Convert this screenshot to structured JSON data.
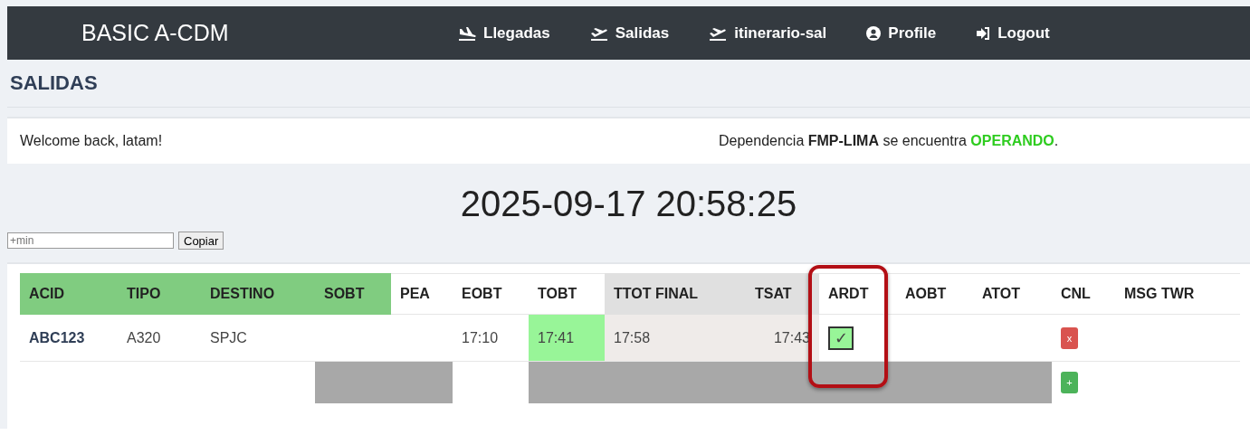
{
  "navbar": {
    "brand": "BASIC A-CDM",
    "items": [
      {
        "kind": "arrival",
        "label": "Llegadas"
      },
      {
        "kind": "departure",
        "label": "Salidas"
      },
      {
        "kind": "departure",
        "label": "itinerario-sal"
      },
      {
        "kind": "user",
        "label": "Profile"
      },
      {
        "kind": "logout",
        "label": "Logout"
      }
    ]
  },
  "page_title": "SALIDAS",
  "welcome": "Welcome back, latam!",
  "status": {
    "text": "Dependencia **FMP-LIMA** se encuentra",
    "state": "OPERANDO",
    "color": "#2ecc1f",
    "suffix": "."
  },
  "clock": "2025-09-17 20:58:25",
  "offset_field": {
    "placeholder": "+min"
  },
  "copy_button": "Copiar",
  "table": {
    "columns": [
      {
        "label": "ACID",
        "color": "#80cc80",
        "highlighted": false
      },
      {
        "label": "TIPO",
        "color": "#80cc80",
        "highlighted": false
      },
      {
        "label": "DESTINO",
        "color": "#80cc80",
        "highlighted": false
      },
      {
        "label": "SOBT",
        "color": "#80cc80",
        "highlighted": false
      },
      {
        "label": "PEA",
        "highlighted": false
      },
      {
        "label": "EOBT",
        "highlighted": false
      },
      {
        "label": "TOBT",
        "highlighted": false
      },
      {
        "label": "TTOT FINAL",
        "color": "#e0e0e0",
        "highlighted": false
      },
      {
        "label": "TSAT",
        "color": "#e0e0e0",
        "highlighted": false
      },
      {
        "label": "ARDT",
        "highlighted": true
      },
      {
        "label": "AOBT",
        "highlighted": false
      },
      {
        "label": "ATOT",
        "highlighted": false
      },
      {
        "label": "CNL",
        "highlighted": false
      },
      {
        "label": "MSG TWR",
        "highlighted": false
      }
    ],
    "rows": [
      {
        "cells": [
          {
            "kind": "id",
            "text": "ABC123"
          },
          {
            "kind": "text",
            "text": "A320"
          },
          {
            "kind": "text",
            "text": "SPJC"
          },
          {
            "kind": "empty"
          },
          {
            "kind": "empty"
          },
          {
            "kind": "text",
            "text": "17:10"
          },
          {
            "kind": "text",
            "text": "17:41",
            "color": "#98f598"
          },
          {
            "kind": "text",
            "text": "17:58",
            "color": "#efebe9"
          },
          {
            "kind": "number",
            "text": "17:43",
            "color": "#efebe9"
          },
          {
            "kind": "check",
            "text": "✓",
            "checked": true
          },
          {
            "kind": "empty"
          },
          {
            "kind": "empty"
          },
          {
            "kind": "cancel",
            "text": "x"
          },
          {
            "kind": "empty"
          }
        ]
      },
      {
        "cells": [
          {
            "kind": "empty"
          },
          {
            "kind": "empty"
          },
          {
            "kind": "empty"
          },
          {
            "kind": "blocked"
          },
          {
            "kind": "blocked"
          },
          {
            "kind": "empty"
          },
          {
            "kind": "blocked"
          },
          {
            "kind": "blocked"
          },
          {
            "kind": "blocked"
          },
          {
            "kind": "blocked"
          },
          {
            "kind": "blocked"
          },
          {
            "kind": "blocked"
          },
          {
            "kind": "add",
            "text": "+"
          },
          {
            "kind": "none"
          }
        ]
      }
    ]
  }
}
